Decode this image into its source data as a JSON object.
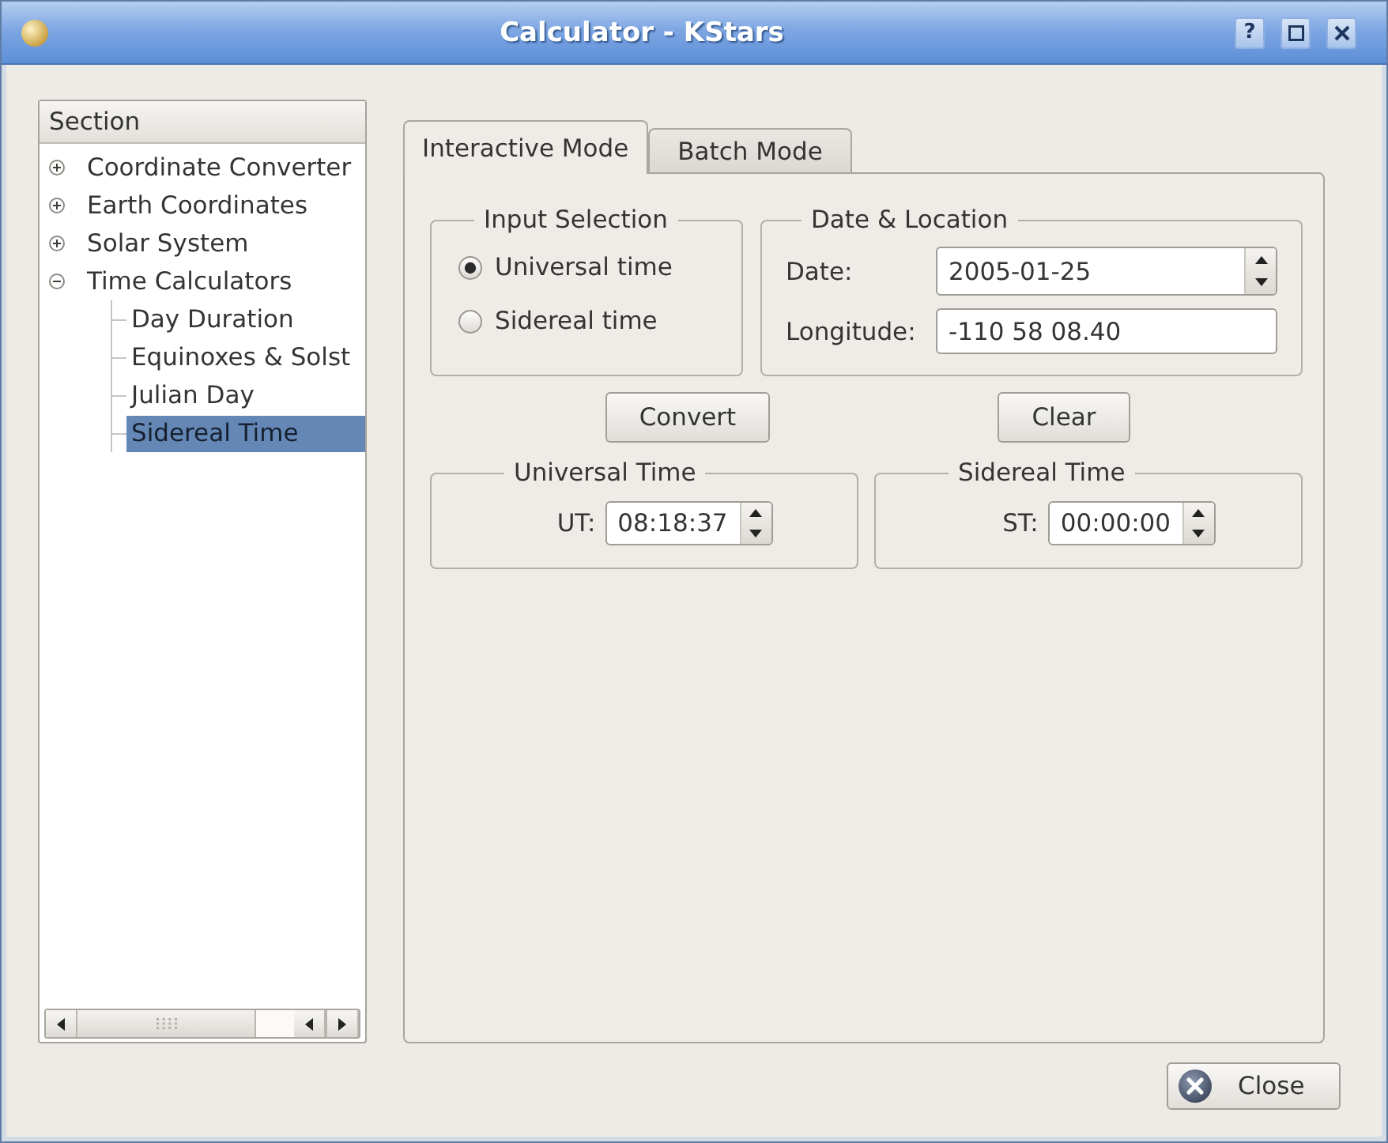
{
  "window": {
    "title": "Calculator - KStars",
    "help_button": "?"
  },
  "sidebar": {
    "header": "Section",
    "items": [
      {
        "label": "Coordinate Converter",
        "expanded": false,
        "selected": false
      },
      {
        "label": "Earth Coordinates",
        "expanded": false,
        "selected": false
      },
      {
        "label": "Solar System",
        "expanded": false,
        "selected": false
      },
      {
        "label": "Time Calculators",
        "expanded": true,
        "selected": false,
        "children": [
          {
            "label": "Day Duration",
            "selected": false
          },
          {
            "label": "Equinoxes & Solst",
            "selected": false
          },
          {
            "label": "Julian Day",
            "selected": false
          },
          {
            "label": "Sidereal Time",
            "selected": true
          }
        ]
      }
    ]
  },
  "tabs": [
    {
      "label": "Interactive Mode",
      "selected": true
    },
    {
      "label": "Batch Mode",
      "selected": false
    }
  ],
  "input_selection": {
    "title": "Input Selection",
    "options": [
      {
        "label": "Universal time",
        "selected": true
      },
      {
        "label": "Sidereal time",
        "selected": false
      }
    ]
  },
  "date_location": {
    "title": "Date & Location",
    "fields": [
      {
        "kind": "spin",
        "label": "Date:",
        "value": "2005-01-25"
      },
      {
        "kind": "text",
        "label": "Longitude:",
        "value": "-110 58 08.40"
      }
    ]
  },
  "convert_button": "Convert",
  "clear_button": "Clear",
  "results": [
    {
      "title": "Universal Time",
      "label": "UT:",
      "value": "08:18:37"
    },
    {
      "title": "Sidereal Time",
      "label": "ST:",
      "value": "00:00:00"
    }
  ],
  "close_button": "Close"
}
